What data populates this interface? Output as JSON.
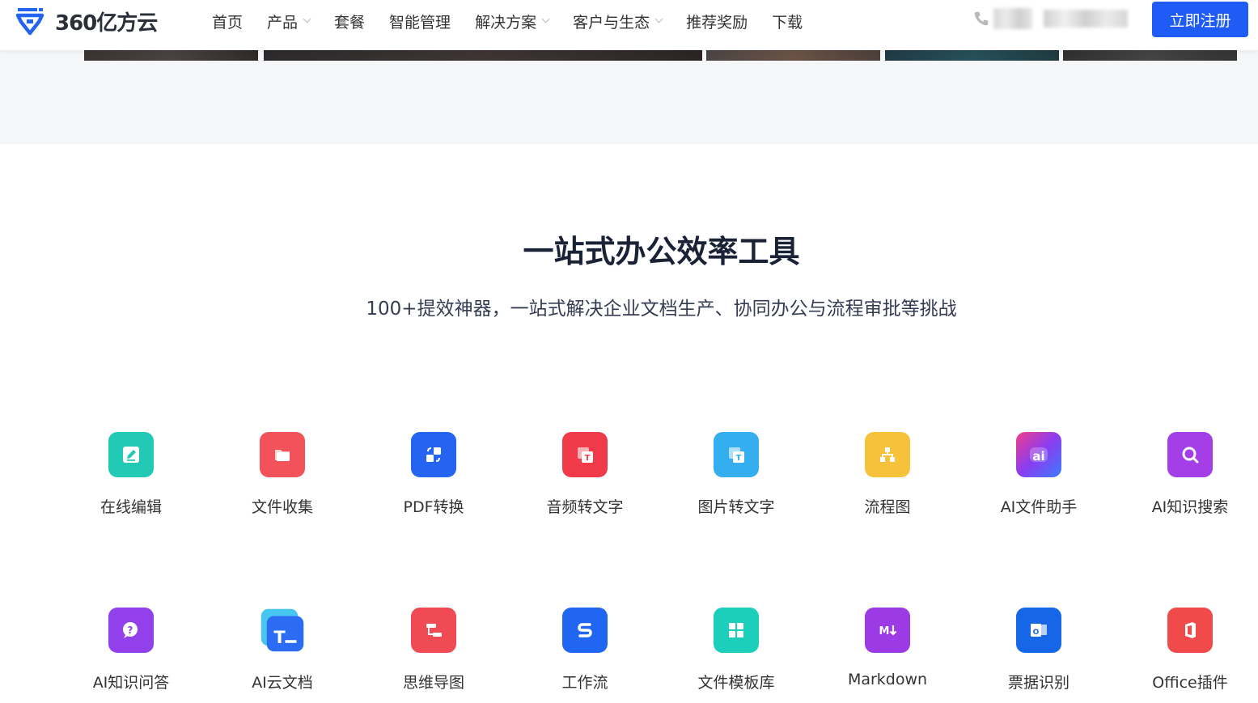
{
  "header": {
    "logo_text": "360亿方云",
    "nav": [
      {
        "label": "首页",
        "has_dropdown": false
      },
      {
        "label": "产品",
        "has_dropdown": true
      },
      {
        "label": "套餐",
        "has_dropdown": false
      },
      {
        "label": "智能管理",
        "has_dropdown": false
      },
      {
        "label": "解决方案",
        "has_dropdown": true
      },
      {
        "label": "客户与生态",
        "has_dropdown": true
      },
      {
        "label": "推荐奖励",
        "has_dropdown": false
      },
      {
        "label": "下载",
        "has_dropdown": false
      }
    ],
    "register_label": "立即注册",
    "accent_color": "#1f5cf5"
  },
  "section": {
    "title": "一站式办公效率工具",
    "subtitle": "100+提效神器，一站式解决企业文档生产、协同办公与流程审批等挑战"
  },
  "tools": [
    {
      "label": "在线编辑",
      "icon": "edit-icon",
      "color": "#22c9b4"
    },
    {
      "label": "文件收集",
      "icon": "folder-icon",
      "color": "#f2525a"
    },
    {
      "label": "PDF转换",
      "icon": "convert-icon",
      "color": "#2464f0"
    },
    {
      "label": "音频转文字",
      "icon": "audio-text-icon",
      "color": "#f03a4a"
    },
    {
      "label": "图片转文字",
      "icon": "image-text-icon",
      "color": "#35aef0"
    },
    {
      "label": "流程图",
      "icon": "flowchart-icon",
      "color": "#f7c23b"
    },
    {
      "label": "AI文件助手",
      "icon": "ai-icon",
      "color": "#8a3df0"
    },
    {
      "label": "AI知识搜索",
      "icon": "search-icon",
      "color": "#a43fe8"
    },
    {
      "label": "AI知识问答",
      "icon": "chat-question-icon",
      "color": "#9240ec"
    },
    {
      "label": "AI云文档",
      "icon": "text-doc-icon",
      "color": "#2c6cf2"
    },
    {
      "label": "思维导图",
      "icon": "mindmap-icon",
      "color": "#f04a55"
    },
    {
      "label": "工作流",
      "icon": "workflow-icon",
      "color": "#2066f2"
    },
    {
      "label": "文件模板库",
      "icon": "template-icon",
      "color": "#1ccfbb"
    },
    {
      "label": "Markdown",
      "icon": "markdown-icon",
      "color": "#9c3be6"
    },
    {
      "label": "票据识别",
      "icon": "outlook-icon",
      "color": "#1567e8"
    },
    {
      "label": "Office插件",
      "icon": "office-icon",
      "color": "#f04a4a"
    }
  ]
}
